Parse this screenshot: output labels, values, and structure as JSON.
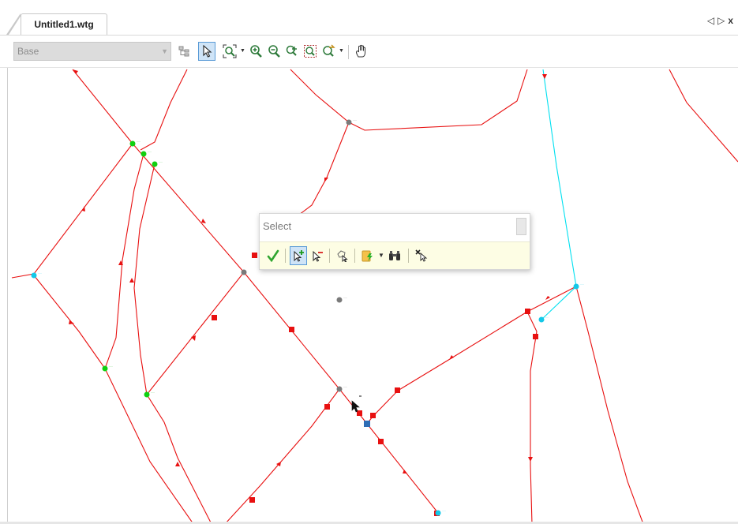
{
  "document_tab": {
    "label": "Untitled1.wtg"
  },
  "window_controls": {
    "left_arrow": "◁",
    "right_arrow": "▷",
    "close": "x"
  },
  "toolbar": {
    "scenario_value": "Base",
    "tools": [
      "tree-icon",
      "pointer-icon",
      "zoom-extents-icon",
      "zoom-in-icon",
      "zoom-out-icon",
      "zoom-window-icon",
      "zoom-realtime-icon",
      "zoom-previous-icon",
      "pan-hand-icon"
    ]
  },
  "select_panel": {
    "title": "Select",
    "tools": [
      "done-check-icon",
      "add-to-selection-icon",
      "remove-from-selection-icon",
      "select-polygon-icon",
      "query-select-icon",
      "find-binoculars-icon",
      "clear-selection-icon"
    ]
  },
  "colors": {
    "pipe": "#e81010",
    "lateral": "#00e0f0",
    "green_node": "#10d010",
    "gray_node": "#7a7a7a",
    "blue_node": "#2e6db5",
    "cyan_node": "#14c8e8",
    "selected_tool_bg": "#cfe4f7",
    "select_toolbar_bg": "#fdfde4"
  },
  "map": {
    "node_label": "....."
  }
}
